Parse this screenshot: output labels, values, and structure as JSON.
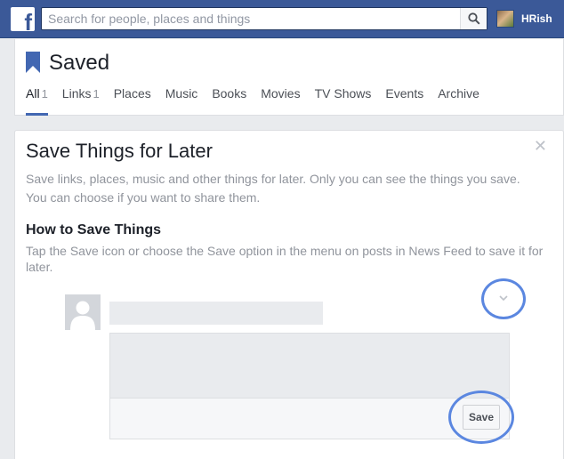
{
  "topbar": {
    "logo_icon": "facebook-f-icon",
    "search_placeholder": "Search for people, places and things",
    "search_icon": "magnifier-icon",
    "username": "HRish"
  },
  "page": {
    "title": "Saved",
    "title_icon": "bookmark-ribbon-icon",
    "accent_color": "#4267b2"
  },
  "tabs": [
    {
      "label": "All",
      "count": "1",
      "active": true
    },
    {
      "label": "Links",
      "count": "1",
      "active": false
    },
    {
      "label": "Places",
      "count": "",
      "active": false
    },
    {
      "label": "Music",
      "count": "",
      "active": false
    },
    {
      "label": "Books",
      "count": "",
      "active": false
    },
    {
      "label": "Movies",
      "count": "",
      "active": false
    },
    {
      "label": "TV Shows",
      "count": "",
      "active": false
    },
    {
      "label": "Events",
      "count": "",
      "active": false
    },
    {
      "label": "Archive",
      "count": "",
      "active": false
    }
  ],
  "card": {
    "close_icon": "close-x-icon",
    "title": "Save Things for Later",
    "description": "Save links, places, music and other things for later. Only you can see the things you save. You can choose if you want to share them.",
    "how_title": "How to Save Things",
    "how_description": "Tap the Save icon or choose the Save option in the menu on posts in News Feed to save it for later.",
    "illustration": {
      "menu_icon": "chevron-down-icon",
      "save_label": "Save",
      "highlight_color": "#5b87e0"
    }
  }
}
